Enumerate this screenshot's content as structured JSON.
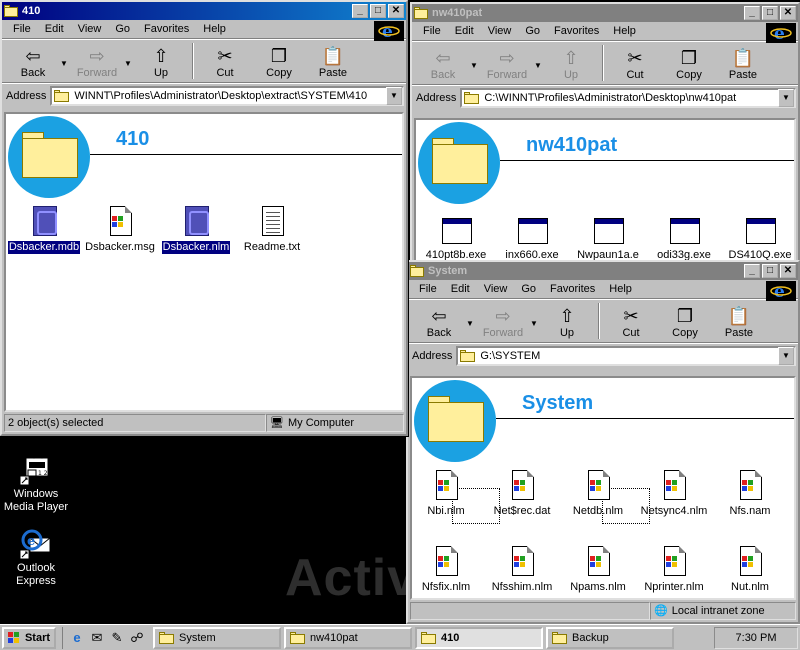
{
  "desktop": {
    "watermark": "Activ",
    "icons": [
      {
        "label_line1": "Windows",
        "label_line2": "Media Player"
      },
      {
        "label_line1": "Outlook",
        "label_line2": "Express"
      }
    ]
  },
  "menus": [
    "File",
    "Edit",
    "View",
    "Go",
    "Favorites",
    "Help"
  ],
  "toolbar": {
    "back": "Back",
    "forward": "Forward",
    "up": "Up",
    "cut": "Cut",
    "copy": "Copy",
    "paste": "Paste"
  },
  "address_label": "Address",
  "win410": {
    "title": "410",
    "address": "WINNT\\Profiles\\Administrator\\Desktop\\extract\\SYSTEM\\410",
    "banner_title": "410",
    "files": [
      {
        "name": "Dsbacker.mdb",
        "selected": true
      },
      {
        "name": "Dsbacker.msg",
        "selected": false
      },
      {
        "name": "Dsbacker.nlm",
        "selected": true
      },
      {
        "name": "Readme.txt",
        "selected": false
      }
    ],
    "status_left": "2 object(s) selected",
    "status_right": "My Computer"
  },
  "winpat": {
    "title": "nw410pat",
    "address": "C:\\WINNT\\Profiles\\Administrator\\Desktop\\nw410pat",
    "banner_title": "nw410pat",
    "files": [
      "410pt8b.exe",
      "inx660.exe",
      "Nwpaun1a.e",
      "odi33g.exe",
      "DS410Q.exe"
    ]
  },
  "winsys": {
    "title": "System",
    "address": "G:\\SYSTEM",
    "banner_title": "System",
    "files_row1": [
      "Nbi.nlm",
      "Net$rec.dat",
      "Netdb.nlm",
      "Netsync4.nlm",
      "Nfs.nam"
    ],
    "files_row2": [
      "Nfsfix.nlm",
      "Nfsshim.nlm",
      "Npams.nlm",
      "Nprinter.nlm",
      "Nut.nlm"
    ],
    "status_right": "Local intranet zone"
  },
  "taskbar": {
    "start": "Start",
    "buttons": [
      {
        "label": "System",
        "pressed": false
      },
      {
        "label": "nw410pat",
        "pressed": false
      },
      {
        "label": "410",
        "pressed": true
      },
      {
        "label": "Backup",
        "pressed": false
      }
    ],
    "clock": "7:30 PM"
  }
}
